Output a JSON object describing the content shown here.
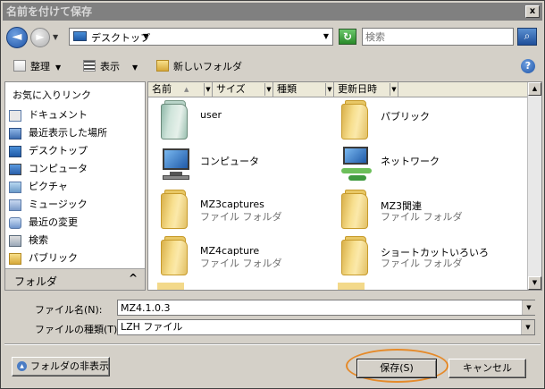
{
  "window": {
    "title": "名前を付けて保存",
    "close_label": "x"
  },
  "address": {
    "back_glyph": "◄",
    "forward_glyph": "►",
    "location": "デスクトップ",
    "search_placeholder": "検索",
    "refresh_icon": "refresh-icon",
    "search_icon": "magnifier-icon"
  },
  "toolbar": {
    "organize_label": "整理",
    "views_label": "表示",
    "new_folder_label": "新しいフォルダ",
    "help_label": "?"
  },
  "favorites": {
    "title": "お気に入りリンク",
    "items": [
      {
        "label": "ドキュメント",
        "icon": "documents-icon"
      },
      {
        "label": "最近表示した場所",
        "icon": "recent-places-icon"
      },
      {
        "label": "デスクトップ",
        "icon": "desktop-icon"
      },
      {
        "label": "コンピュータ",
        "icon": "computer-icon"
      },
      {
        "label": "ピクチャ",
        "icon": "pictures-icon"
      },
      {
        "label": "ミュージック",
        "icon": "music-icon"
      },
      {
        "label": "最近の変更",
        "icon": "recent-changes-icon"
      },
      {
        "label": "検索",
        "icon": "search-folder-icon"
      },
      {
        "label": "パブリック",
        "icon": "public-folder-icon"
      }
    ],
    "folder_bar_label": "フォルダ",
    "folder_bar_caret": "^"
  },
  "columns": [
    {
      "label": "名前"
    },
    {
      "label": "サイズ"
    },
    {
      "label": "種類"
    },
    {
      "label": "更新日時"
    }
  ],
  "files": [
    {
      "name": "user",
      "type": "",
      "icon": "user-folder-icon"
    },
    {
      "name": "パブリック",
      "type": "",
      "icon": "folder-icon"
    },
    {
      "name": "コンピュータ",
      "type": "",
      "icon": "computer-icon"
    },
    {
      "name": "ネットワーク",
      "type": "",
      "icon": "network-icon"
    },
    {
      "name": "MZ3captures",
      "type": "ファイル フォルダ",
      "icon": "folder-icon"
    },
    {
      "name": "MZ3関連",
      "type": "ファイル フォルダ",
      "icon": "folder-icon"
    },
    {
      "name": "MZ4capture",
      "type": "ファイル フォルダ",
      "icon": "folder-icon"
    },
    {
      "name": "ショートカットいろいろ",
      "type": "ファイル フォルダ",
      "icon": "folder-icon"
    }
  ],
  "form": {
    "filename_label": "ファイル名(N):",
    "filename_value": "MZ4.1.0.3",
    "filetype_label": "ファイルの種類(T):",
    "filetype_value": "LZH ファイル"
  },
  "buttons": {
    "hide_folders": "フォルダの非表示",
    "save": "保存(S)",
    "cancel": "キャンセル"
  },
  "colors": {
    "highlight": "#e58a2a"
  }
}
